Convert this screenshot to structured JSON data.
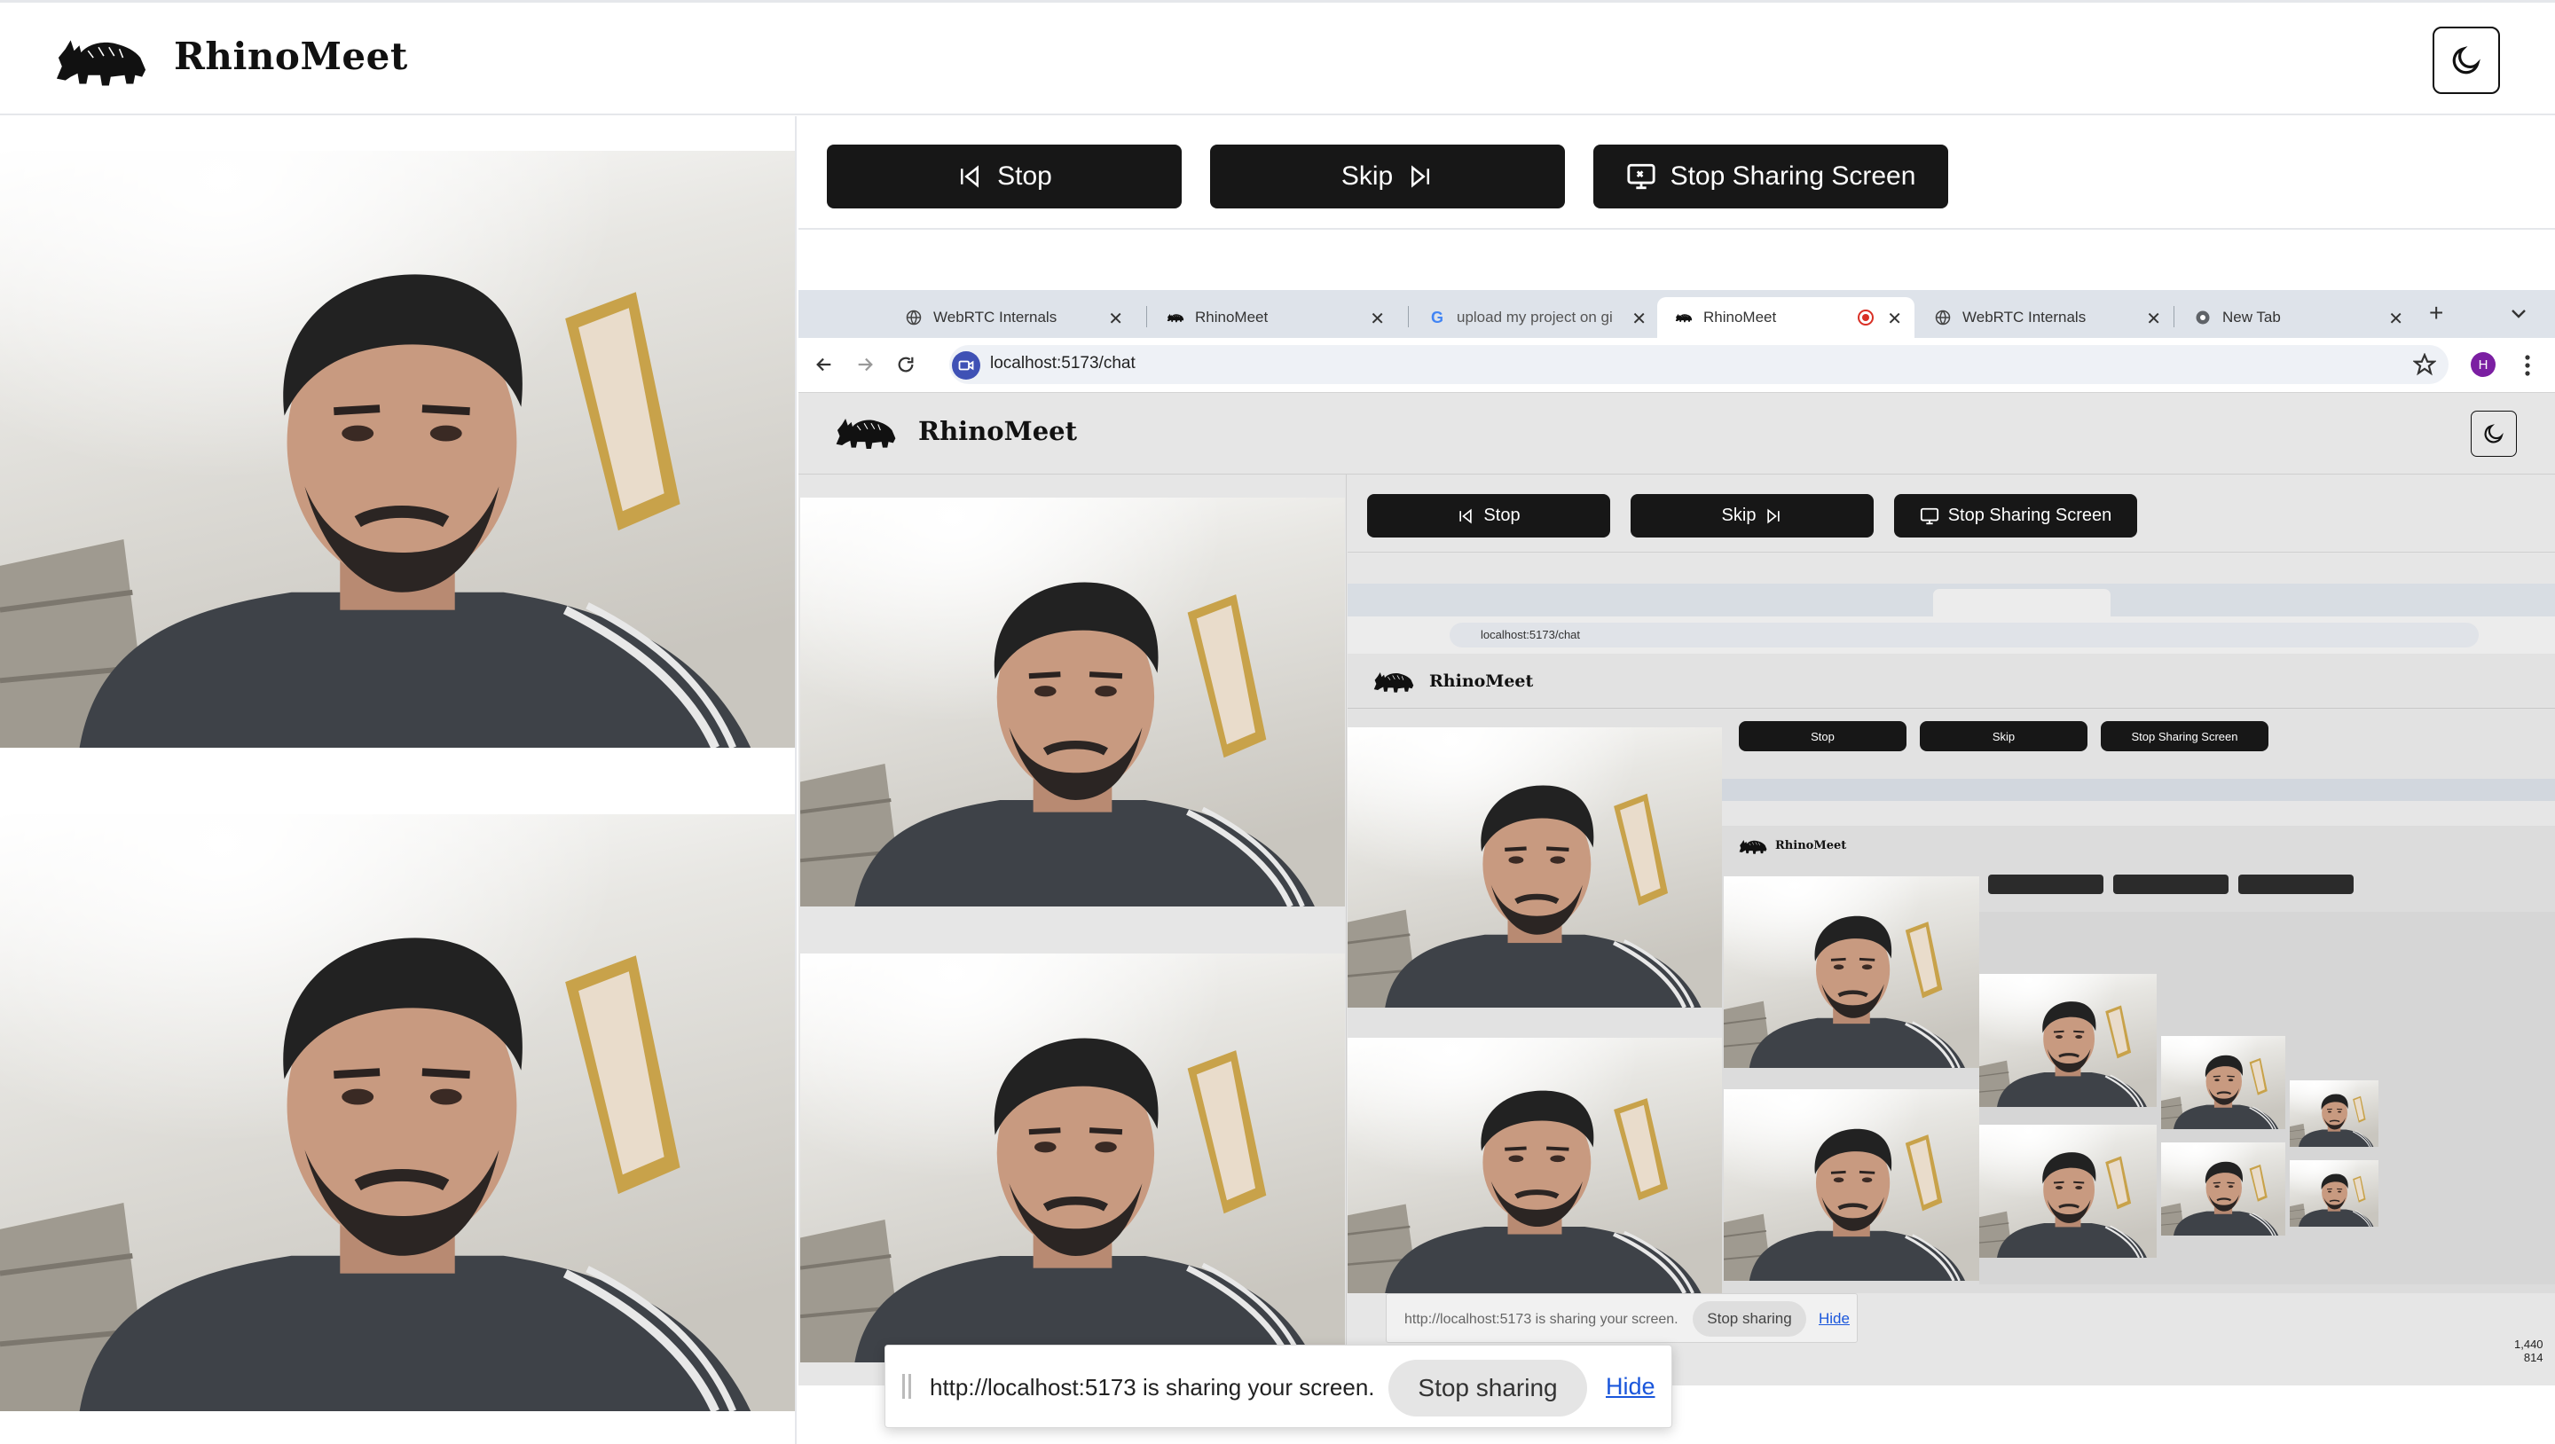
{
  "app": {
    "title": "RhinoMeet"
  },
  "controls": {
    "stop_label": "Stop",
    "skip_label": "Skip",
    "stop_share_label": "Stop Sharing Screen"
  },
  "browser": {
    "tabs": [
      {
        "label": "WebRTC Internals",
        "icon": "globe-icon"
      },
      {
        "label": "RhinoMeet",
        "icon": "rhino-icon"
      },
      {
        "label": "upload my project on gi",
        "icon": "google-icon"
      },
      {
        "label": "RhinoMeet",
        "icon": "rhino-icon",
        "active": true,
        "recording": true
      },
      {
        "label": "WebRTC Internals",
        "icon": "globe-icon"
      },
      {
        "label": "New Tab",
        "icon": "chrome-icon"
      }
    ],
    "url": "localhost:5173/chat",
    "profile_initial": "H"
  },
  "screen_size": {
    "line1": "1,440",
    "line2": "814"
  },
  "nested_note": {
    "text": "http://localhost:5173 is sharing your screen.",
    "stop": "Stop sharing",
    "hide": "Hide"
  },
  "notification": {
    "text": "http://localhost:5173 is sharing your screen.",
    "stop_label": "Stop sharing",
    "hide_label": "Hide"
  },
  "colors": {
    "button_bg": "#171717",
    "button_text": "#ffffff",
    "link": "#1a56db",
    "recording": "#d93025",
    "avatar": "#7b1fa2"
  }
}
